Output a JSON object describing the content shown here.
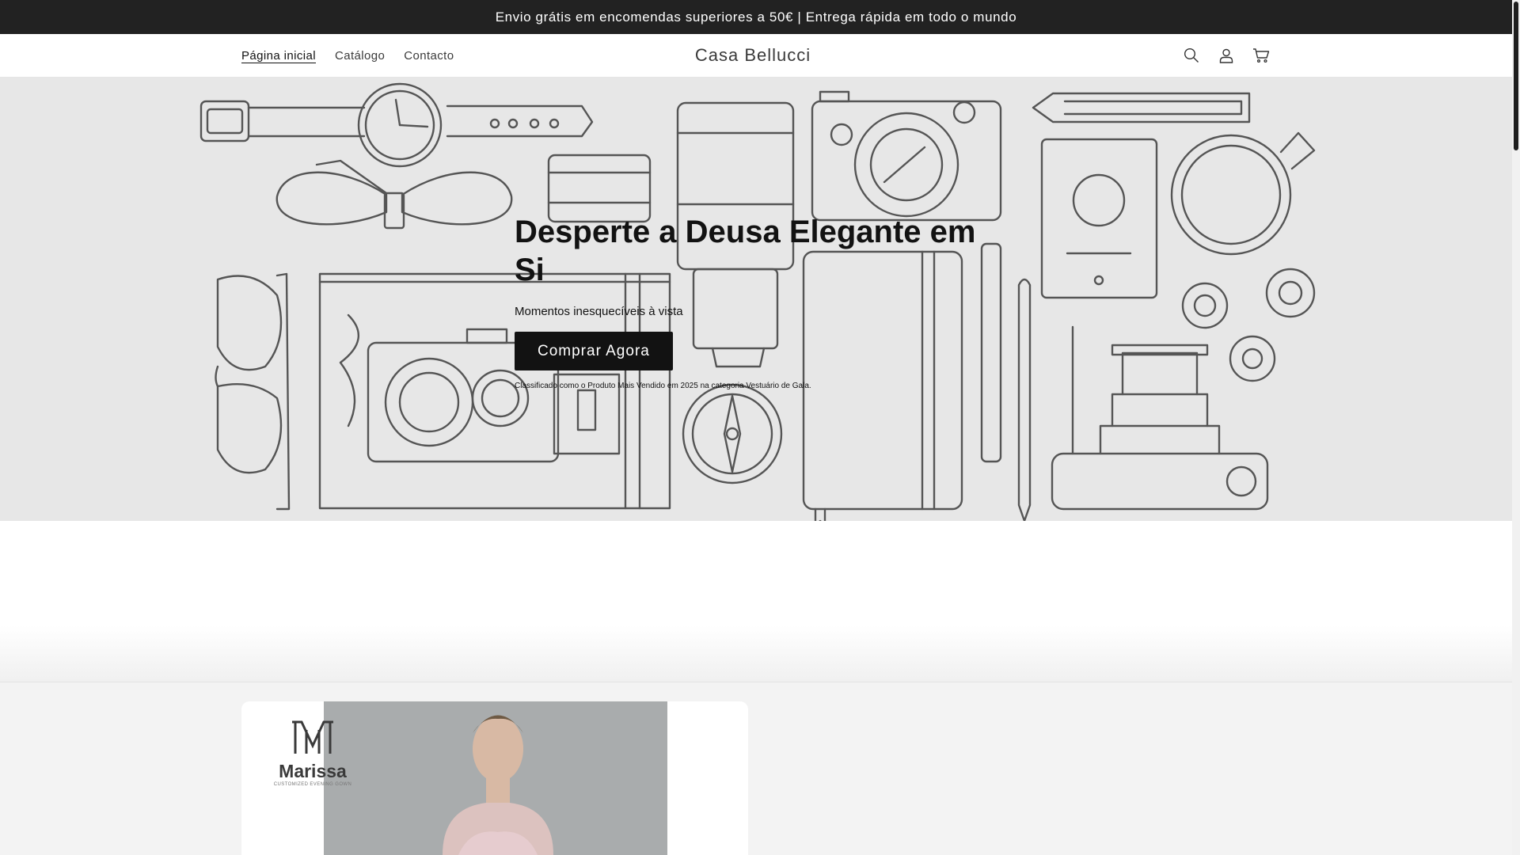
{
  "announcement": {
    "text": "Envio grátis em encomendas superiores a 50€ | Entrega rápida em todo o mundo"
  },
  "header": {
    "nav": [
      "Página inicial",
      "Catálogo",
      "Contacto"
    ],
    "logo": "Casa Bellucci",
    "icons": [
      "search-icon",
      "account-icon",
      "cart-icon"
    ]
  },
  "hero": {
    "title": "Desperte a Deusa Elegante em Si",
    "subtitle": "Momentos inesquecíveis à vista",
    "button": "Comprar Agora",
    "note": "Classificado como o Produto Mais Vendido em 2025 na categoria Vestuário de Gala."
  },
  "product": {
    "brand_name": "Marissa",
    "brand_tagline": "CUSTOMIZED EVENING GOWN"
  },
  "colors": {
    "announcement_bg": "#222222",
    "hero_bg": "#e7e7e7",
    "button_bg": "#121212",
    "line_art": "#555555"
  }
}
